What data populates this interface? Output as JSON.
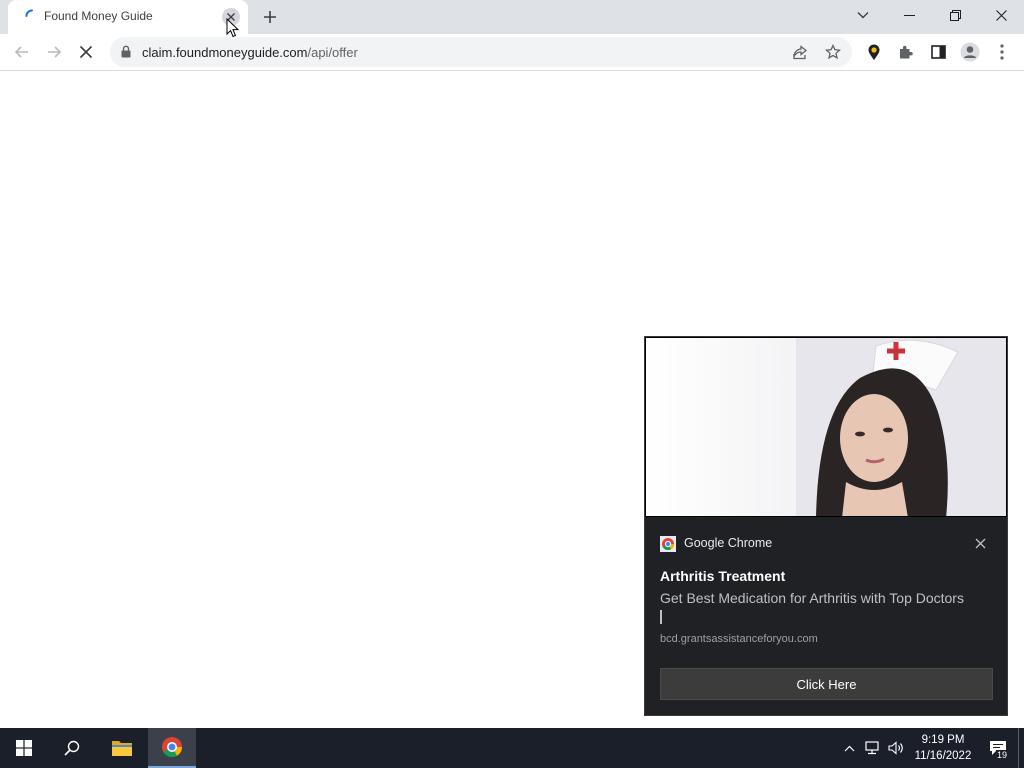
{
  "browser": {
    "tab": {
      "title": "Found Money Guide"
    },
    "address": {
      "domain": "claim.foundmoneyguide.com",
      "path": "/api/offer"
    }
  },
  "notification": {
    "app_name": "Google Chrome",
    "title": "Arthritis Treatment",
    "body": "Get Best Medication for Arthritis with Top Doctors",
    "source": "bcd.grantsassistanceforyou.com",
    "button_label": "Click Here"
  },
  "taskbar": {
    "time": "9:19 PM",
    "date": "11/16/2022",
    "notification_count": "19"
  },
  "colors": {
    "tabstrip": "#dee1e6",
    "toast_bg": "#202124",
    "taskbar_bg": "#1a1f29",
    "chrome_blue": "#1a73e8"
  }
}
